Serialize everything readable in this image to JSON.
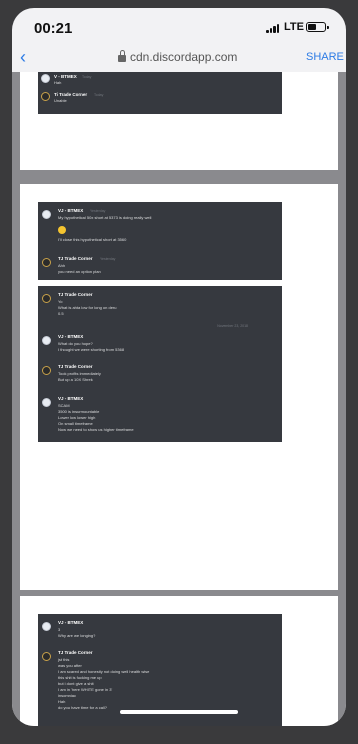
{
  "status_bar": {
    "time": "00:21",
    "network": "LTE"
  },
  "browser": {
    "back_label": "‹",
    "url": "cdn.discordapp.com",
    "share_label": "SHARE"
  },
  "page1": {
    "messages": [
      {
        "user": "V - BTMEX",
        "time": "Today",
        "lines": [
          "Hah"
        ]
      },
      {
        "user": "Ti Trade Corner",
        "time": "Today",
        "lines": [
          "Unable"
        ]
      }
    ]
  },
  "page2": {
    "shot1": [
      {
        "user": "VJ - BTMEX",
        "time": "Yesterday",
        "lines": [
          "My hypothetical 50x short at 5373 is doing really well"
        ]
      },
      {
        "user": "",
        "time": "",
        "lines": [
          "I'll close this hypothetical short at 3560"
        ]
      },
      {
        "user": "TJ Trade Corner",
        "time": "Yesterday",
        "lines": [
          "Ahh",
          "you need an option plan"
        ]
      }
    ],
    "shot2_separator": "November 23, 2018",
    "shot2": [
      {
        "user": "TJ Trade Corner",
        "time": "",
        "lines": [
          "Yo",
          "What is ahta low for long on deru",
          "0.5"
        ]
      },
      {
        "user": "VJ - BTMEX",
        "time": "",
        "lines": [
          "What do you hope?",
          "I thought we were shorting from 5368"
        ]
      },
      {
        "user": "TJ Trade Corner",
        "time": "",
        "lines": [
          "Took profits immediately",
          "But up a 10X Shrek"
        ]
      },
      {
        "user": "VJ - BTMEX",
        "time": "",
        "lines": [
          "SCAM",
          "3500 is insurmountable",
          "Lower low lower high",
          "On small timeframe",
          "Now we need to show us higher timeframe"
        ]
      }
    ]
  },
  "page3": {
    "messages": [
      {
        "user": "VJ - BTMEX",
        "time": "",
        "lines": [
          "3",
          "Why are we longing?"
        ]
      },
      {
        "user": "TJ Trade Corner",
        "time": "",
        "lines": [
          "jst this",
          "was you after",
          "I am scared and honestly not doing well health wise",
          "this shit is fucking me up",
          "but i dont give a shit",
          "I am in 'here WHITE gone in 3'",
          "insomniac",
          "Hah",
          "do you have time for a call?"
        ]
      }
    ]
  }
}
